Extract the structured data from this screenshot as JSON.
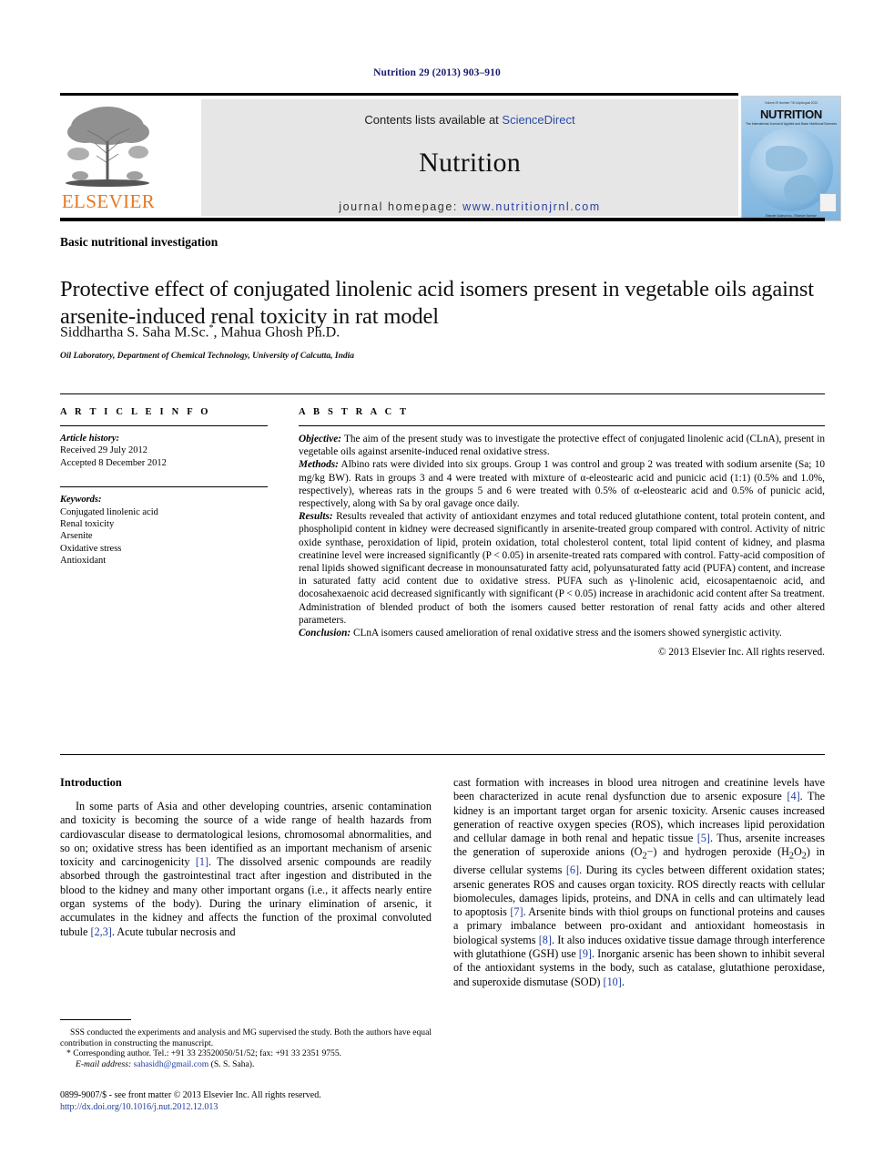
{
  "running_head": "Nutrition 29 (2013) 903–910",
  "masthead": {
    "contents_prefix": "Contents lists available at ",
    "sciencedirect": "ScienceDirect",
    "journal_name": "Nutrition",
    "homepage_prefix": "journal homepage: ",
    "homepage_url": "www.nutritionjrnl.com",
    "publisher_logo_text": "ELSEVIER",
    "cover": {
      "title": "NUTRITION",
      "tiny_top": "Volume 29 Number 7/8  July/August 2013",
      "subtitle": "The International Journal of Applied and Basic Nutritional Sciences",
      "bottom": "Elsevier Science Inc. / Elsevier Science"
    },
    "link_color": "#2b4ba8"
  },
  "article": {
    "section_type": "Basic nutritional investigation",
    "title": "Protective effect of conjugated linolenic acid isomers present in vegetable oils against arsenite-induced renal toxicity in rat model",
    "authors": "Siddhartha S. Saha M.Sc.",
    "author_marker": "*",
    "authors_rest": ", Mahua Ghosh Ph.D.",
    "affiliation": "Oil Laboratory, Department of Chemical Technology, University of Calcutta, India"
  },
  "article_info": {
    "heading": "A R T I C L E   I N F O",
    "history_label": "Article history:",
    "received": "Received 29 July 2012",
    "accepted": "Accepted 8 December 2012",
    "keywords_label": "Keywords:",
    "keywords": [
      "Conjugated linolenic acid",
      "Renal toxicity",
      "Arsenite",
      "Oxidative stress",
      "Antioxidant"
    ]
  },
  "abstract": {
    "heading": "A B S T R A C T",
    "objective_label": "Objective:",
    "objective_text": " The aim of the present study was to investigate the protective effect of conjugated linolenic acid (CLnA), present in vegetable oils against arsenite-induced renal oxidative stress.",
    "methods_label": "Methods:",
    "methods_text": " Albino rats were divided into six groups. Group 1 was control and group 2 was treated with sodium arsenite (Sa; 10 mg/kg BW). Rats in groups 3 and 4 were treated with mixture of α-eleostearic acid and punicic acid (1:1) (0.5% and 1.0%, respectively), whereas rats in the groups 5 and 6 were treated with 0.5% of α-eleostearic acid and 0.5% of punicic acid, respectively, along with Sa by oral gavage once daily.",
    "results_label": "Results:",
    "results_text": " Results revealed that activity of antioxidant enzymes and total reduced glutathione content, total protein content, and phospholipid content in kidney were decreased significantly in arsenite-treated group compared with control. Activity of nitric oxide synthase, peroxidation of lipid, protein oxidation, total cholesterol content, total lipid content of kidney, and plasma creatinine level were increased significantly (P < 0.05) in arsenite-treated rats compared with control. Fatty-acid composition of renal lipids showed significant decrease in monounsaturated fatty acid, polyunsaturated fatty acid (PUFA) content, and increase in saturated fatty acid content due to oxidative stress. PUFA such as γ-linolenic acid, eicosapentaenoic acid, and docosahexaenoic acid decreased significantly with significant (P < 0.05) increase in arachidonic acid content after Sa treatment. Administration of blended product of both the isomers caused better restoration of renal fatty acids and other altered parameters.",
    "conclusion_label": "Conclusion:",
    "conclusion_text": " CLnA isomers caused amelioration of renal oxidative stress and the isomers showed synergistic activity.",
    "copyright": "© 2013 Elsevier Inc. All rights reserved."
  },
  "body": {
    "intro_heading": "Introduction",
    "left_para_1_a": "In some parts of Asia and other developing countries, arsenic contamination and toxicity is becoming the source of a wide range of health hazards from cardiovascular disease to dermatological lesions, chromosomal abnormalities, and so on; oxidative stress has been identified as an important mechanism of arsenic toxicity and carcinogenicity ",
    "left_ref_1": "[1]",
    "left_para_1_b": ". The dissolved arsenic compounds are readily absorbed through the gastrointestinal tract after ingestion and distributed in the blood to the kidney and many other important organs (i.e., it affects nearly entire organ systems of the body). During the urinary elimination of arsenic, it accumulates in the kidney and affects the function of the proximal convoluted tubule ",
    "left_ref_2": "[2,3]",
    "left_para_1_c": ". Acute tubular necrosis and",
    "right_para_a": "cast formation with increases in blood urea nitrogen and creatinine levels have been characterized in acute renal dysfunction due to arsenic exposure ",
    "right_ref_4": "[4]",
    "right_para_b": ". The kidney is an important target organ for arsenic toxicity. Arsenic causes increased generation of reactive oxygen species (ROS), which increases lipid peroxidation and cellular damage in both renal and hepatic tissue ",
    "right_ref_5": "[5]",
    "right_para_c": ". Thus, arsenite increases the generation of superoxide anions (O",
    "right_sub_1": "2",
    "right_para_c2": "−) and hydrogen peroxide (H",
    "right_sub_2": "2",
    "right_para_c3": "O",
    "right_sub_3": "2",
    "right_para_c4": ") in diverse cellular systems ",
    "right_ref_6": "[6]",
    "right_para_d": ". During its cycles between different oxidation states; arsenic generates ROS and causes organ toxicity. ROS directly reacts with cellular biomolecules, damages lipids, proteins, and DNA in cells and can ultimately lead to apoptosis ",
    "right_ref_7": "[7]",
    "right_para_e": ". Arsenite binds with thiol groups on functional proteins and causes a primary imbalance between pro-oxidant and antioxidant homeostasis in biological systems ",
    "right_ref_8": "[8]",
    "right_para_f": ". It also induces oxidative tissue damage through interference with glutathione (GSH) use ",
    "right_ref_9": "[9]",
    "right_para_g": ". Inorganic arsenic has been shown to inhibit several of the antioxidant systems in the body, such as catalase, glutathione peroxidase, and superoxide dismutase (SOD) ",
    "right_ref_10": "[10]",
    "right_para_h": "."
  },
  "footnotes": {
    "contribution": "SSS conducted the experiments and analysis and MG supervised the study. Both the authors have equal contribution in constructing the manuscript.",
    "corresponding_marker": "*",
    "corresponding": " Corresponding author. Tel.: +91 33 23520050/51/52; fax: +91 33 2351 9755.",
    "email_label": "E-mail address:",
    "email": "sahasidh@gmail.com",
    "email_suffix": " (S. S. Saha).",
    "issn_line": "0899-9007/$ - see front matter © 2013 Elsevier Inc. All rights reserved.",
    "doi": "http://dx.doi.org/10.1016/j.nut.2012.12.013"
  }
}
